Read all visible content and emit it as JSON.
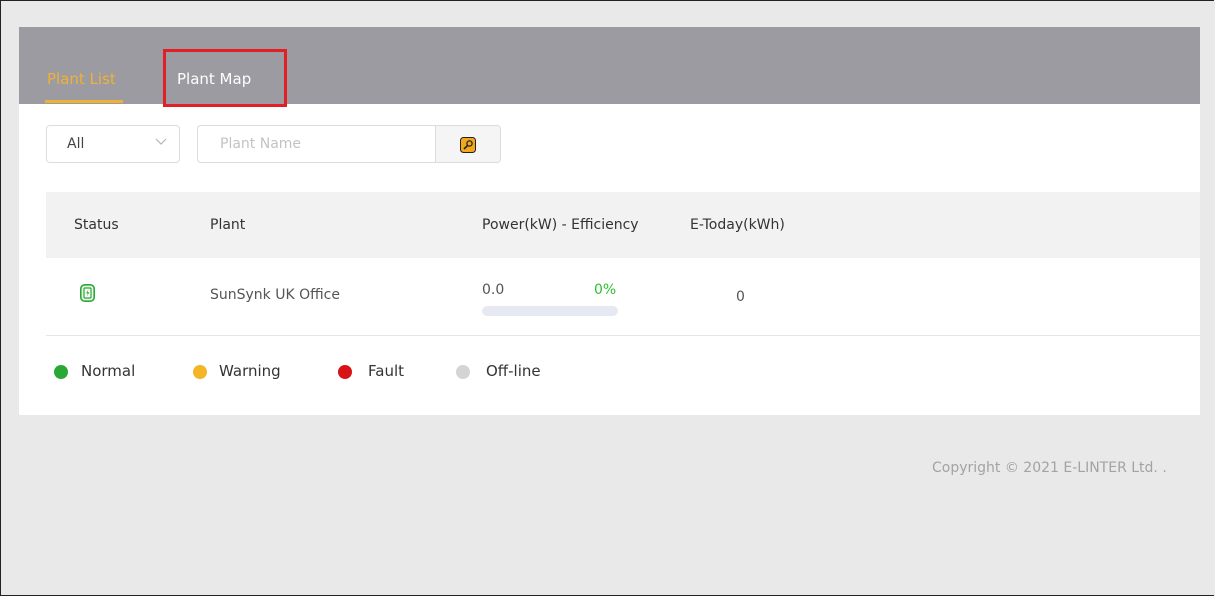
{
  "tabs": {
    "plant_list": "Plant List",
    "plant_map": "Plant Map"
  },
  "filters": {
    "status_select_value": "All",
    "plant_name_placeholder": "Plant Name",
    "search_button_icon": "search-icon"
  },
  "table": {
    "headers": {
      "status": "Status",
      "plant": "Plant",
      "power_efficiency": "Power(kW) - Efficiency",
      "e_today": "E-Today(kWh)"
    },
    "rows": [
      {
        "status_icon": "plant-status-normal-icon",
        "plant": "SunSynk UK Office",
        "power": "0.0",
        "efficiency": "0%",
        "efficiency_fraction": 0,
        "e_today": "0"
      }
    ]
  },
  "legend": [
    {
      "label": "Normal",
      "color": "#2aa836"
    },
    {
      "label": "Warning",
      "color": "#f4b526"
    },
    {
      "label": "Fault",
      "color": "#d81216"
    },
    {
      "label": "Off-line",
      "color": "#d4d4d4"
    }
  ],
  "footer": {
    "copyright": "Copyright © 2021 E-LINTER Ltd. ."
  },
  "colors": {
    "accent": "#f0b236",
    "tabbar": "#9b9ba1",
    "highlight": "#e21f26"
  }
}
